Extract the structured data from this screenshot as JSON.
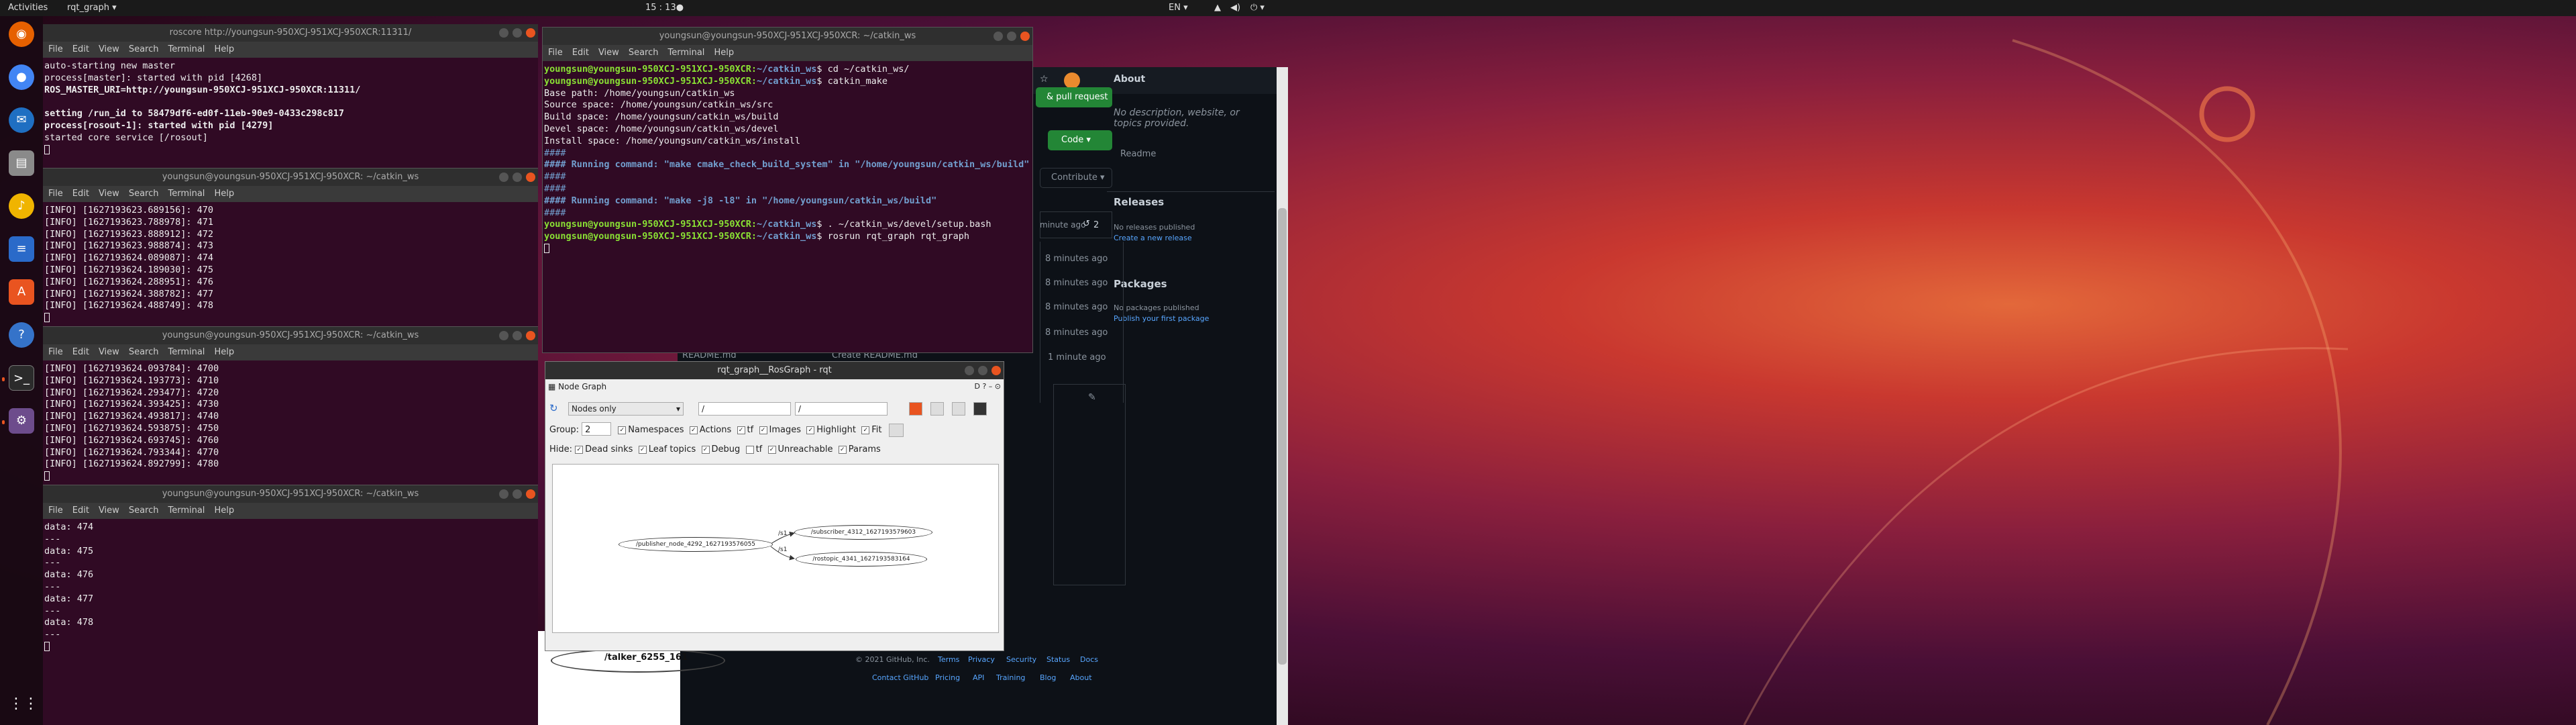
{
  "topbar": {
    "activities": "Activities",
    "app_menu": "rqt_graph ▾",
    "clock": "15 : 13●",
    "lang": "EN ▾"
  },
  "dock": {
    "icons": [
      "firefox-icon",
      "chrome-icon",
      "thunderbird-icon",
      "files-icon",
      "rhythmbox-icon",
      "writer-icon",
      "software-icon",
      "help-icon",
      "terminal-icon",
      "rqt-icon"
    ],
    "apps_grid": "⋮⋮⋮"
  },
  "term1": {
    "title": "roscore http://youngsun-950XCJ-951XCJ-950XCR:11311/",
    "lines": [
      "auto-starting new master",
      "process[master]: started with pid [4268]",
      "ROS_MASTER_URI=http://youngsun-950XCJ-951XCJ-950XCR:11311/",
      "",
      "setting /run_id to 58479df6-ed0f-11eb-90e9-0433c298c817",
      "process[rosout-1]: started with pid [4279]",
      "started core service [/rosout]"
    ]
  },
  "menu": {
    "file": "File",
    "edit": "Edit",
    "view": "View",
    "search": "Search",
    "terminal": "Terminal",
    "help": "Help"
  },
  "term2": {
    "title": "youngsun@youngsun-950XCJ-951XCJ-950XCR: ~/catkin_ws",
    "lines": [
      "[INFO] [1627193623.689156]: 470",
      "[INFO] [1627193623.788978]: 471",
      "[INFO] [1627193623.888912]: 472",
      "[INFO] [1627193623.988874]: 473",
      "[INFO] [1627193624.089087]: 474",
      "[INFO] [1627193624.189030]: 475",
      "[INFO] [1627193624.288951]: 476",
      "[INFO] [1627193624.388782]: 477",
      "[INFO] [1627193624.488749]: 478"
    ]
  },
  "term3": {
    "title": "youngsun@youngsun-950XCJ-951XCJ-950XCR: ~/catkin_ws",
    "lines": [
      "[INFO] [1627193624.093784]: 4700",
      "[INFO] [1627193624.193773]: 4710",
      "[INFO] [1627193624.293477]: 4720",
      "[INFO] [1627193624.393425]: 4730",
      "[INFO] [1627193624.493817]: 4740",
      "[INFO] [1627193624.593875]: 4750",
      "[INFO] [1627193624.693745]: 4760",
      "[INFO] [1627193624.793344]: 4770",
      "[INFO] [1627193624.892799]: 4780"
    ]
  },
  "term4": {
    "title": "youngsun@youngsun-950XCJ-951XCJ-950XCR: ~/catkin_ws",
    "lines": [
      "data: 474",
      "---",
      "data: 475",
      "---",
      "data: 476",
      "---",
      "data: 477",
      "---",
      "data: 478",
      "---"
    ]
  },
  "term5": {
    "title": "youngsun@youngsun-950XCJ-951XCJ-950XCR: ~/catkin_ws",
    "prompt": "youngsun@youngsun-950XCJ-951XCJ-950XCR:",
    "path": "~/catkin_ws",
    "cmd1": "$ cd ~/catkin_ws/",
    "cmd2": "$ catkin_make",
    "out": [
      "Base path: /home/youngsun/catkin_ws",
      "Source space: /home/youngsun/catkin_ws/src",
      "Build space: /home/youngsun/catkin_ws/build",
      "Devel space: /home/youngsun/catkin_ws/devel",
      "Install space: /home/youngsun/catkin_ws/install",
      "####",
      "#### Running command: \"make cmake_check_build_system\" in \"/home/youngsun/catkin_ws/build\"",
      "####",
      "####",
      "#### Running command: \"make -j8 -l8\" in \"/home/youngsun/catkin_ws/build\"",
      "####"
    ],
    "cmd3": "$ . ~/catkin_ws/devel/setup.bash",
    "cmd4": "$ rosrun rqt_graph rqt_graph"
  },
  "github": {
    "about": "About",
    "desc": "No description, website, or topics provided.",
    "readme": "Readme",
    "releases": "Releases",
    "no_releases": "No releases published",
    "create_release": "Create a new release",
    "packages": "Packages",
    "no_packages": "No packages published",
    "publish_package": "Publish your first package",
    "pull_request": "& pull request",
    "code": "Code ▾",
    "contribute": "Contribute ▾",
    "times": [
      "minute ago",
      "8 minutes ago",
      "8 minutes ago",
      "8 minutes ago",
      "8 minutes ago",
      "1 minute ago"
    ],
    "commits": "2",
    "readme_md": "README.md",
    "create_readme": "Create README.md",
    "footer": [
      "© 2021 GitHub, Inc.",
      "Terms",
      "Privacy",
      "Security",
      "Status",
      "Docs",
      "Contact GitHub",
      "Pricing",
      "API",
      "Training",
      "Blog",
      "About"
    ]
  },
  "rqt": {
    "title": "rqt_graph__RosGraph - rqt",
    "plugin": "Node Graph",
    "dropdown": "Nodes only",
    "filter1": "/",
    "filter2": "/",
    "group_label": "Group:",
    "group_value": "2",
    "namespaces": "Namespaces",
    "actions": "Actions",
    "tf": "tf",
    "images": "Images",
    "highlight": "Highlight",
    "fit": "Fit",
    "hide_label": "Hide:",
    "dead_sinks": "Dead sinks",
    "leaf_topics": "Leaf topics",
    "debug": "Debug",
    "tf2": "tf",
    "unreachable": "Unreachable",
    "params": "Params",
    "nodes": [
      "/publisher_node_4292_1627193576055",
      "/subscriber_4312_1627193579603",
      "/rostopic_4341_1627193583164"
    ],
    "edges": [
      "/s1",
      "/s1"
    ],
    "behind_node": "/talker_6255_161"
  }
}
